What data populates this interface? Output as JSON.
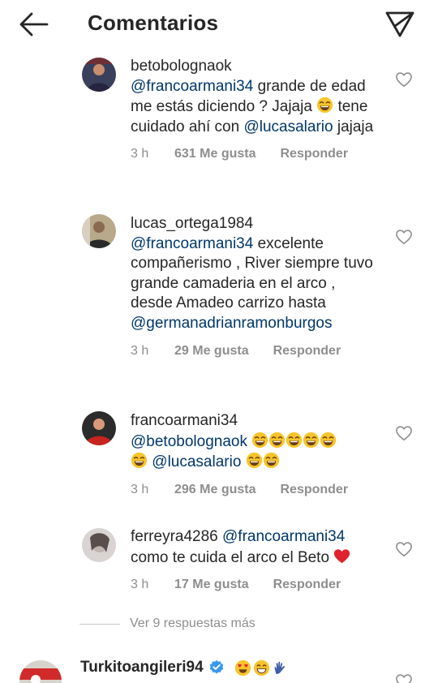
{
  "header": {
    "title": "Comentarios"
  },
  "comments": [
    {
      "username": "betobolognaok",
      "mention": "@francoarmani34",
      "text1": " grande de edad me estás diciendo ? Jajaja ",
      "text2": " tene cuidado ahí con ",
      "mention2": "@lucasalario",
      "text3": " jajaja",
      "time": "3 h",
      "likes": "631 Me gusta",
      "reply": "Responder"
    },
    {
      "username": "lucas_ortega1984",
      "mention": "@francoarmani34",
      "text1": " excelente compañerismo , River siempre tuvo grande camaderia en el arco , desde Amadeo carrizo hasta ",
      "mention2": "@germanadrianramonburgos",
      "time": "3 h",
      "likes": "29 Me gusta",
      "reply": "Responder"
    },
    {
      "username": "francoarmani34",
      "mention": "@betobolognaok",
      "mention2": "@lucasalario",
      "time": "3 h",
      "likes": "296 Me gusta",
      "reply": "Responder"
    },
    {
      "username": "ferreyra4286",
      "mention": "@francoarmani34",
      "text1": "como te cuida el arco el Beto ",
      "time": "3 h",
      "likes": "17 Me gusta",
      "reply": "Responder"
    }
  ],
  "view_replies": "Ver 9 respuestas más",
  "last_comment": {
    "username": "Turkitoangileri94"
  },
  "icons": [
    "back-arrow-icon",
    "send-icon",
    "heart-icon",
    "verified-badge-icon",
    "laughing-emoji-icon",
    "red-heart-emoji-icon"
  ]
}
